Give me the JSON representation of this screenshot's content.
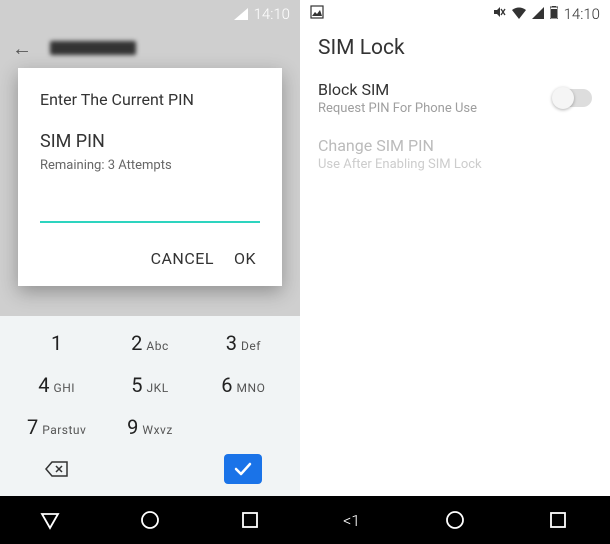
{
  "left": {
    "status_time": "14:10",
    "modal": {
      "title": "Enter The Current PIN",
      "subtitle": "SIM PIN",
      "hint": "Remaining: 3 Attempts",
      "cancel": "CANCEL",
      "ok": "OK"
    },
    "keypad": {
      "k1": "1",
      "k2": "2",
      "k2s": "Abc",
      "k3": "3",
      "k3s": "Def",
      "k4": "4",
      "k4s": "GHI",
      "k5": "5",
      "k5s": "JKL",
      "k6": "6",
      "k6s": "MNO",
      "k7": "7",
      "k7s": "Parstuv",
      "k9": "9",
      "k9s": "Wxvz"
    }
  },
  "right": {
    "status_time": "14:10",
    "title": "SIM Lock",
    "block": {
      "label": "Block SIM",
      "desc": "Request PIN For Phone Use"
    },
    "change": {
      "label": "Change SIM PIN",
      "desc": "Use After Enabling SIM Lock"
    },
    "nav_back": "<1"
  }
}
